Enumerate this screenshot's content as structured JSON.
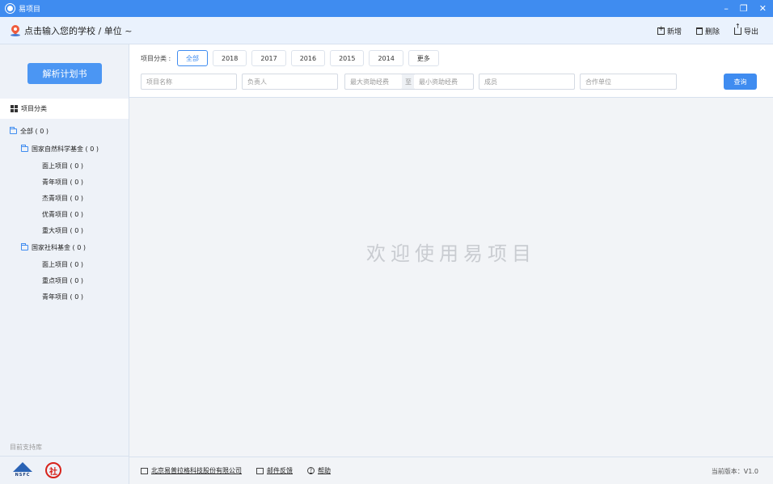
{
  "window": {
    "title": "易项目",
    "controls": {
      "minimize": "–",
      "restore": "❐",
      "close": "✕"
    }
  },
  "header": {
    "school_placeholder": "点击输入您的学校 / 单位 ~",
    "actions": [
      {
        "label": "新增",
        "icon": "plus-box-icon"
      },
      {
        "label": "删除",
        "icon": "trash-icon"
      },
      {
        "label": "导出",
        "icon": "export-icon"
      }
    ]
  },
  "sidebar": {
    "parse_button": "解析计划书",
    "category_header": "项目分类",
    "tree": [
      {
        "label": "全部 ( 0 )",
        "level": 0,
        "folder": true
      },
      {
        "label": "国家自然科学基金 ( 0 )",
        "level": 1,
        "folder": true
      },
      {
        "label": "面上项目 ( 0 )",
        "level": 2
      },
      {
        "label": "青年项目 ( 0 )",
        "level": 2
      },
      {
        "label": "杰青项目 ( 0 )",
        "level": 2
      },
      {
        "label": "优青项目 ( 0 )",
        "level": 2
      },
      {
        "label": "重大项目 ( 0 )",
        "level": 2
      },
      {
        "label": "国家社科基金 ( 0 )",
        "level": 1,
        "folder": true
      },
      {
        "label": "面上项目 ( 0 )",
        "level": 2
      },
      {
        "label": "重点项目 ( 0 )",
        "level": 2
      },
      {
        "label": "青年项目 ( 0 )",
        "level": 2
      }
    ],
    "support_label": "目前支持库",
    "logo_nsfc_text": "NSFC",
    "logo_sskj_text": "社"
  },
  "filter": {
    "label": "项目分类 :",
    "years": [
      "全部",
      "2018",
      "2017",
      "2016",
      "2015",
      "2014",
      "更多"
    ],
    "active_year": "全部",
    "inputs": {
      "project_name": "项目名称",
      "leader": "负责人",
      "max_fund": "最大资助经费",
      "to": "至",
      "min_fund": "最小资助经费",
      "member": "成员",
      "partner": "合作单位"
    },
    "query_button": "查询"
  },
  "main": {
    "welcome": "欢迎使用易项目"
  },
  "footer": {
    "company": "北京易普拉格科技股份有限公司",
    "feedback": "邮件反馈",
    "help": "帮助",
    "help_icon_glyph": "?",
    "version": "当前版本：V1.0"
  },
  "colors": {
    "accent": "#3f8cf0",
    "button": "#4b96f3",
    "pin": "#ef5b3c"
  }
}
